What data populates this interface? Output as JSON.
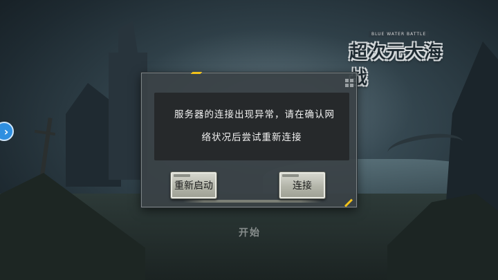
{
  "dialog": {
    "message_line1": "服务器的连接出现异常，请在确认网",
    "message_line2": "络状况后尝试重新连接",
    "restart_label": "重新启动",
    "connect_label": "连接",
    "accent_color": "#f2c21a"
  },
  "logo": {
    "title": "超次元大海战",
    "subtitle": "BLUE WATER BATTLE"
  },
  "start_label": "开始",
  "side_arrow_icon": "chevron-right-icon",
  "colors": {
    "button_face": "#c7c8bd",
    "message_bg": "#26292b",
    "side_arrow": "#2f8fe0"
  }
}
